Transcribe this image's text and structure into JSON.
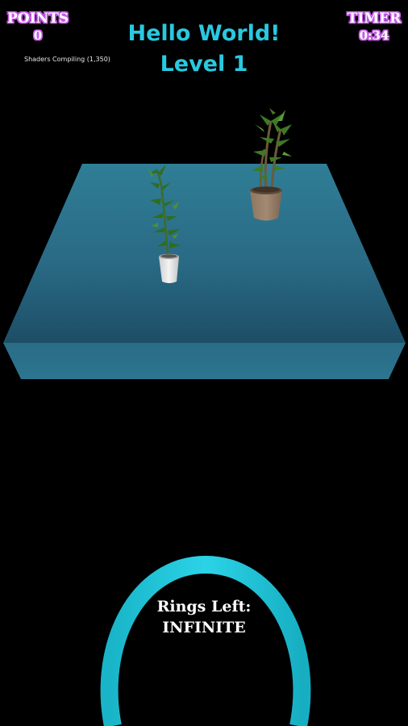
{
  "hud": {
    "points_title": "POINTS",
    "points_value": "0",
    "timer_title": "TIMER",
    "timer_value": "0:34",
    "heading_line1": "Hello World!",
    "heading_line2": "Level 1",
    "shader_status": "Shaders Compiling (1,350)"
  },
  "rings": {
    "label_line1": "Rings Left:",
    "label_line2": "INFINITE"
  },
  "scene": {
    "table_color": "#2b6f8a",
    "ring_color": "#20c4d8",
    "objects": [
      "plant-white-pot",
      "plant-brown-pot",
      "toss-ring"
    ]
  },
  "colors": {
    "heading": "#29c9e0",
    "hud_outline": "#c65de6",
    "background": "#000000"
  }
}
